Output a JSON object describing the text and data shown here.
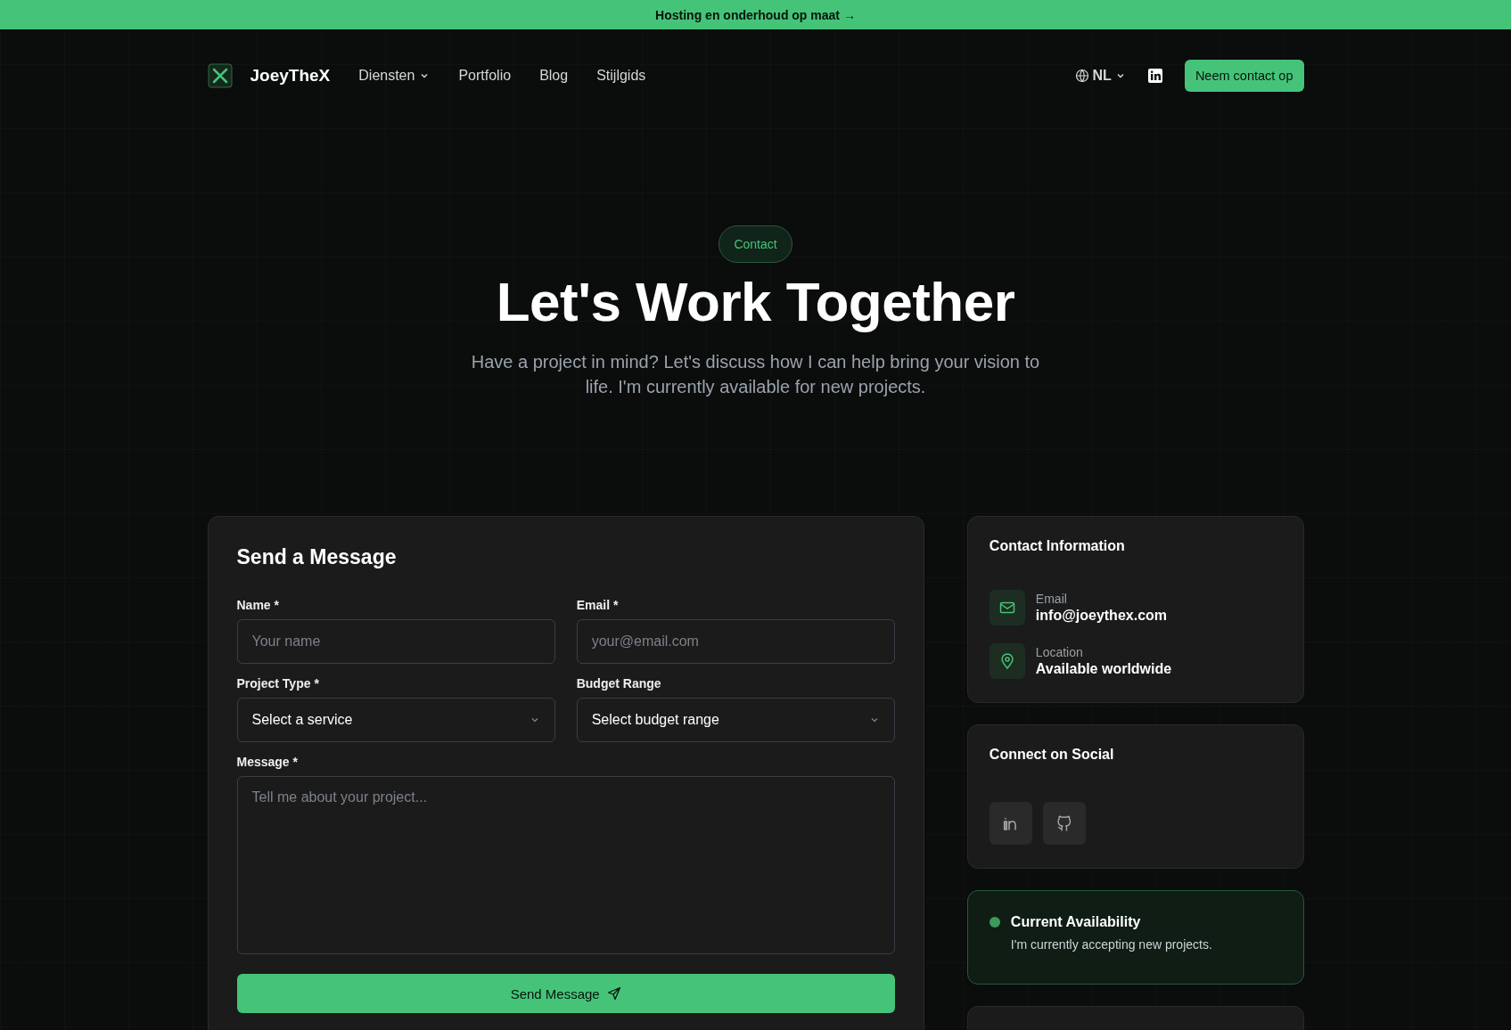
{
  "banner": {
    "text": "Hosting en onderhoud op maat →"
  },
  "nav": {
    "brand": "JoeyTheX",
    "links": [
      {
        "label": "Diensten",
        "dropdown": true
      },
      {
        "label": "Portfolio",
        "dropdown": false
      },
      {
        "label": "Blog",
        "dropdown": false
      },
      {
        "label": "Stijlgids",
        "dropdown": false
      }
    ],
    "language": "NL",
    "cta": "Neem contact op"
  },
  "hero": {
    "badge": "Contact",
    "title": "Let's Work Together",
    "subtitle": "Have a project in mind? Let's discuss how I can help bring your vision to life. I'm currently available for new projects."
  },
  "form": {
    "title": "Send a Message",
    "fields": [
      {
        "kind": "input",
        "label": "Name *",
        "placeholder": "Your name"
      },
      {
        "kind": "input",
        "label": "Email *",
        "placeholder": "your@email.com"
      },
      {
        "kind": "select",
        "label": "Project Type *",
        "value": "Select a service"
      },
      {
        "kind": "select",
        "label": "Budget Range",
        "value": "Select budget range"
      },
      {
        "kind": "textarea",
        "label": "Message *",
        "placeholder": "Tell me about your project..."
      }
    ],
    "submit": "Send Message"
  },
  "contact_info": {
    "title": "Contact Information",
    "items": [
      {
        "kind": "email",
        "label": "Email",
        "value": "info@joeythex.com"
      },
      {
        "kind": "location",
        "label": "Location",
        "value": "Available worldwide"
      }
    ]
  },
  "social": {
    "title": "Connect on Social",
    "links": [
      {
        "kind": "linkedin"
      },
      {
        "kind": "github"
      }
    ]
  },
  "availability": {
    "available": true,
    "title": "Current Availability",
    "text": "I'm currently accepting new projects."
  }
}
